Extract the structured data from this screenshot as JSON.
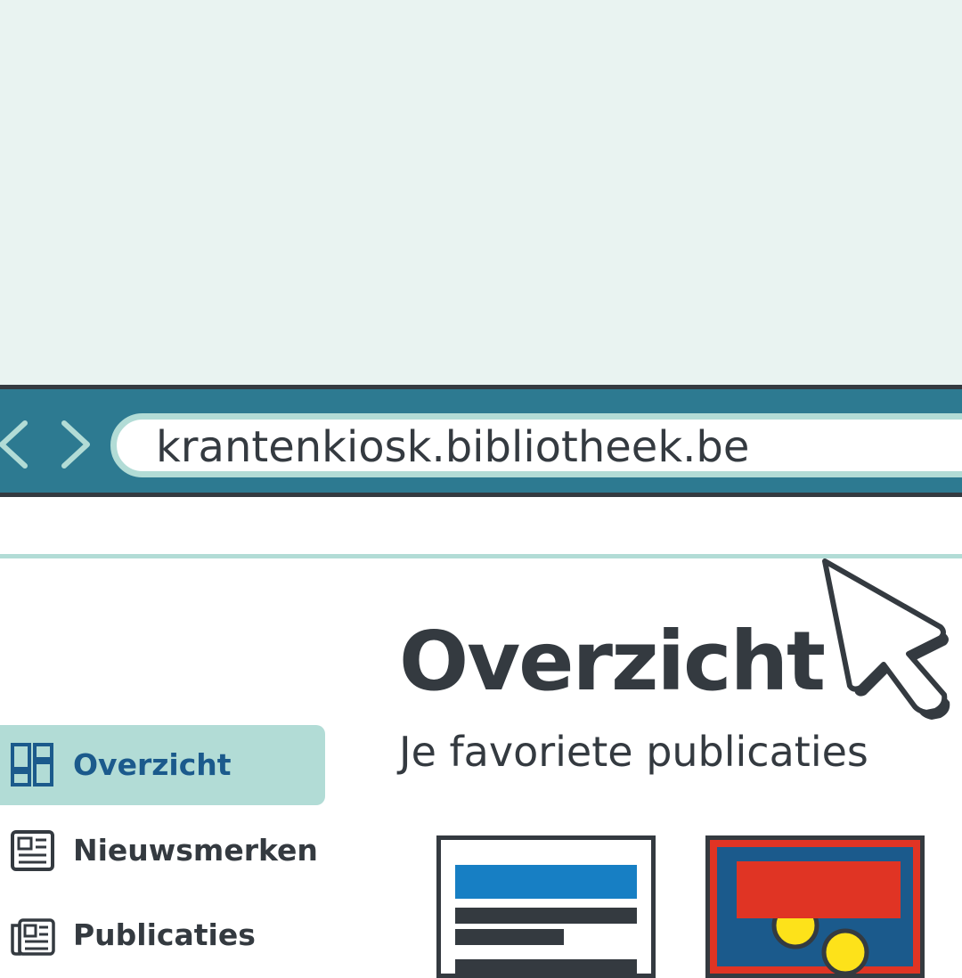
{
  "browser": {
    "url": "krantenkiosk.bibliotheek.be",
    "back_icon": "chevron-left-icon",
    "forward_icon": "chevron-right-icon"
  },
  "page": {
    "title": "Overzicht",
    "subtitle": "Je favoriete publicaties"
  },
  "sidebar": {
    "items": [
      {
        "label": "Overzicht",
        "icon": "dashboard-grid-icon",
        "active": true
      },
      {
        "label": "Nieuwsmerken",
        "icon": "newspaper-icon",
        "active": false
      },
      {
        "label": "Publicaties",
        "icon": "newspapers-stack-icon",
        "active": false
      }
    ]
  },
  "colors": {
    "toolbar": "#2d7a91",
    "accent_light": "#b2dcd6",
    "active_text": "#1b5a8c",
    "text": "#343a40",
    "card_blue": "#1b5a8c",
    "card_red": "#e03424",
    "card_yellow": "#fde21a",
    "card_highlight": "#177fc4"
  }
}
